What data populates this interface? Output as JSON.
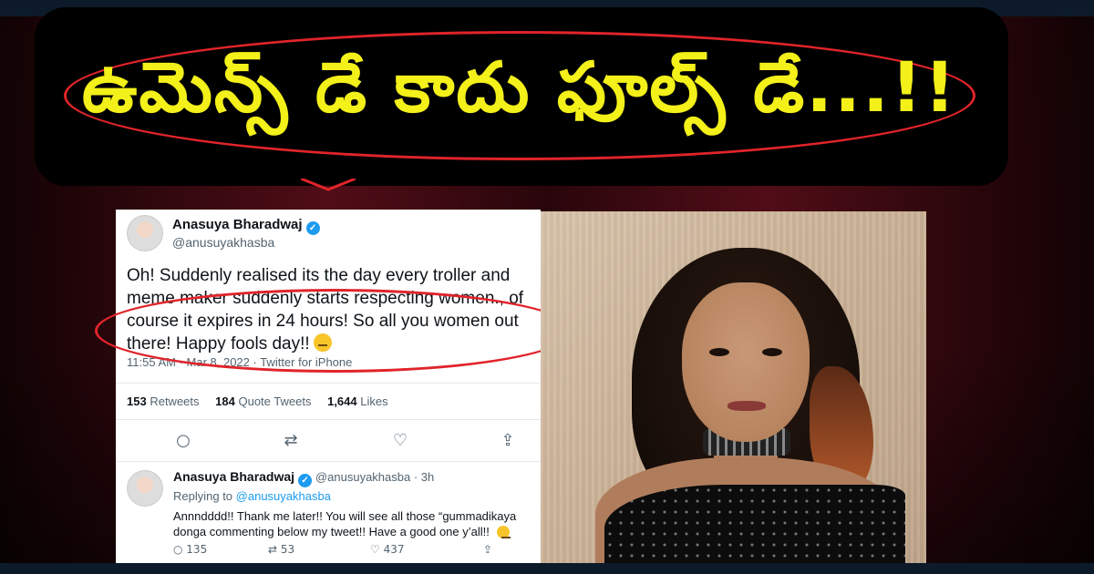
{
  "headline": {
    "text": "ఉమెన్స్ డే కాదు ఫూల్స్ డే...!!",
    "text_color": "#f3f01a",
    "oval_color": "#e0242a"
  },
  "tweet": {
    "author_name": "Anasuya Bharadwaj",
    "author_handle": "@anusuyakhasba",
    "body": "Oh! Suddenly realised its the day every troller and meme maker suddenly starts respecting women., of course it expires in 24 hours! So all you women out there! Happy fools day!!",
    "timestamp": "11:55 AM · Mar 8, 2022 · Twitter for iPhone",
    "stats": {
      "retweets_count": "153",
      "retweets_label": "Retweets",
      "quote_count": "184",
      "quote_label": "Quote Tweets",
      "likes_count": "1,644",
      "likes_label": "Likes"
    },
    "icons": [
      "reply-icon",
      "retweet-icon",
      "like-icon",
      "share-icon"
    ]
  },
  "reply": {
    "author_name": "Anasuya Bharadwaj",
    "author_handle": "@anusuyakhasba · 3h",
    "replying_prefix": "Replying to ",
    "replying_to": "@anusuyakhasba",
    "body": "Annndddd!! Thank me later!! You will see all those “gummadikaya donga commenting below my tweet!! Have a good one y’all!!",
    "replies": "135",
    "retweets": "53",
    "likes": "437"
  },
  "colors": {
    "accent_blue": "#1d9bf0",
    "highlight_red": "#e0242a",
    "headline_yellow": "#f3f01a"
  }
}
